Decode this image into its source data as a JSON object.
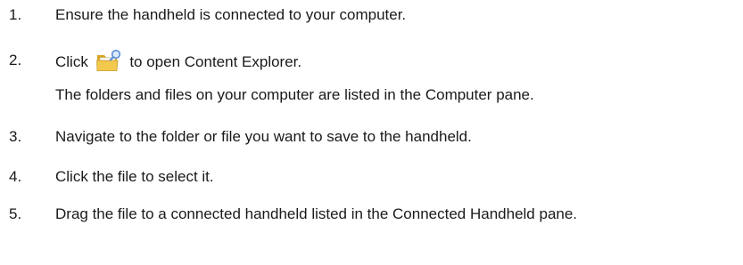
{
  "steps": [
    {
      "number": "1.",
      "text": "Ensure the handheld is connected to your computer."
    },
    {
      "number": "2.",
      "text_before": "Click",
      "icon": "content-explorer-icon",
      "text_after": "to open Content Explorer.",
      "note": "The folders and files on your computer are listed in the Computer pane."
    },
    {
      "number": "3.",
      "text": "Navigate to the folder or file you want to save to the handheld."
    },
    {
      "number": "4.",
      "text": "Click the file to select it."
    },
    {
      "number": "5.",
      "text": "Drag the file to a connected handheld listed in the Connected Handheld pane."
    }
  ],
  "colors": {
    "text": "#1a1a1a",
    "folder": "#f2c94c",
    "folder_dark": "#d8a521",
    "magnifier": "#5b8fd6"
  }
}
